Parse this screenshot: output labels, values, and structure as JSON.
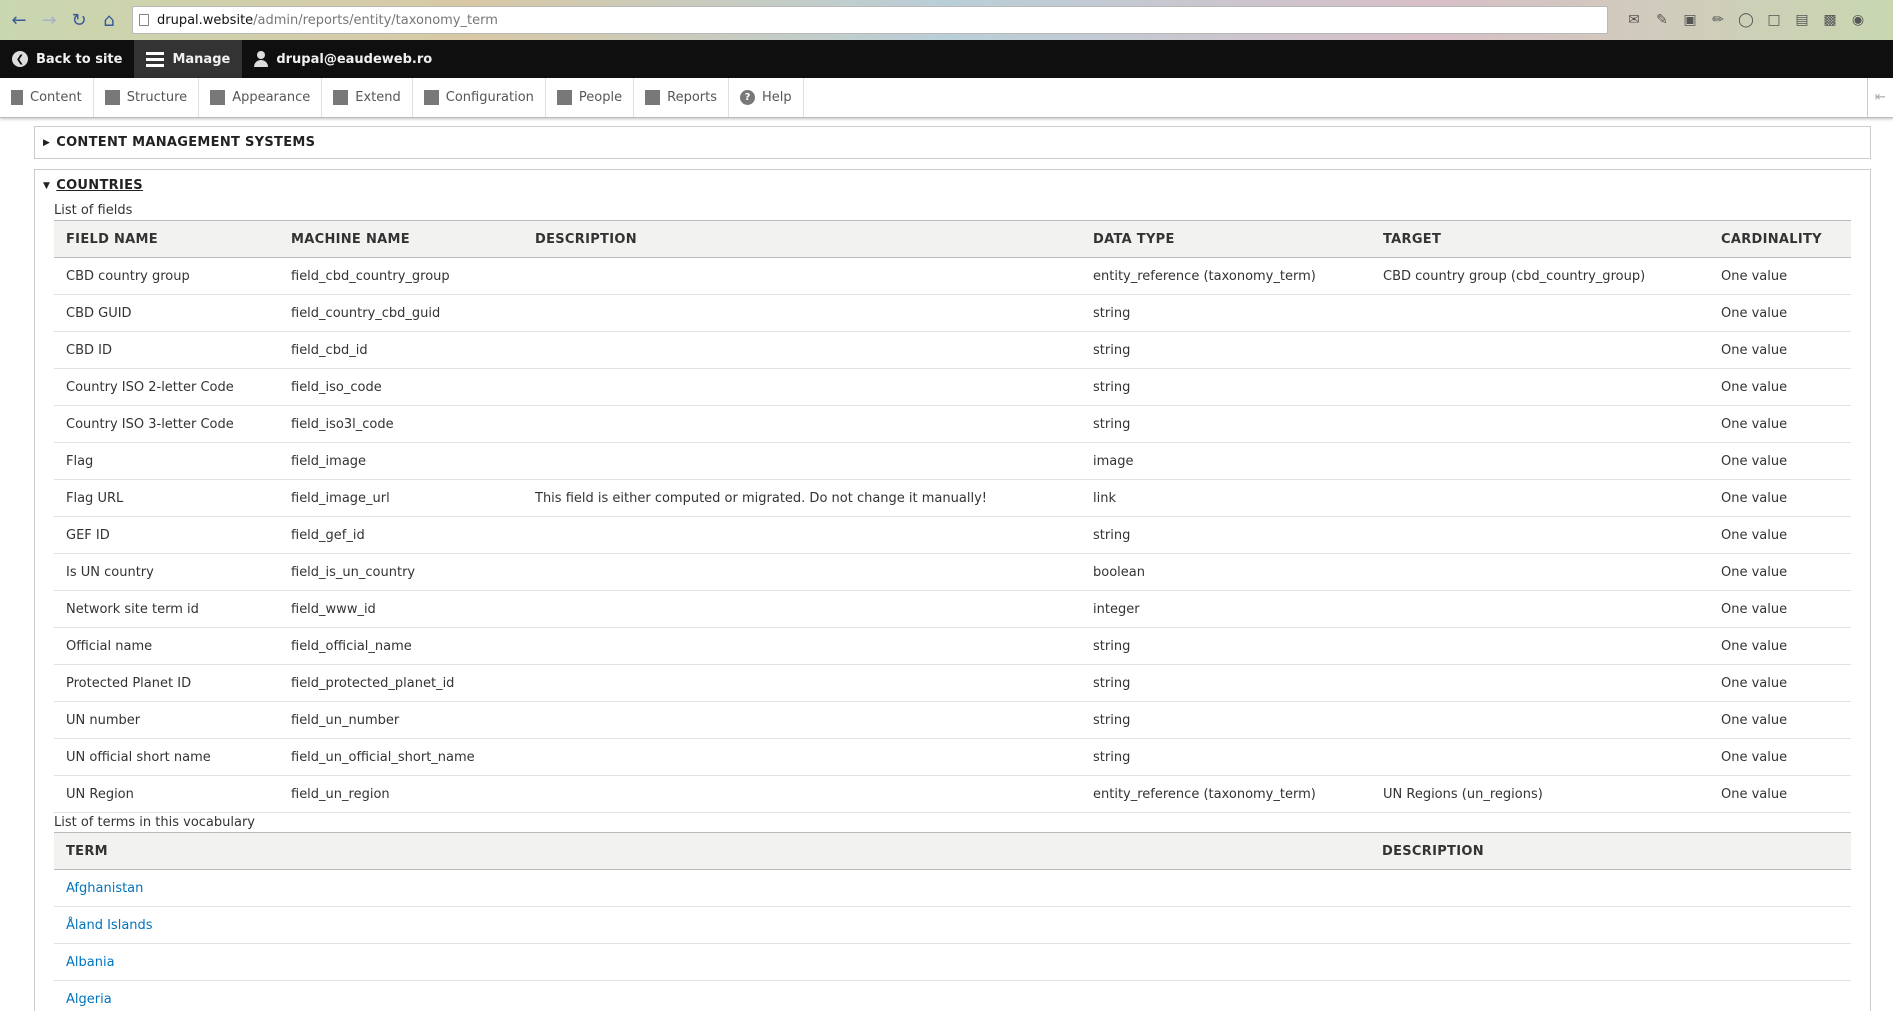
{
  "browser": {
    "url_host": "drupal.website",
    "url_path": "/admin/reports/entity/taxonomy_term"
  },
  "toolbar": {
    "back_label": "Back to site",
    "manage_label": "Manage",
    "user_label": "drupal@eaudeweb.ro"
  },
  "tray": {
    "items": [
      "Content",
      "Structure",
      "Appearance",
      "Extend",
      "Configuration",
      "People",
      "Reports",
      "Help"
    ]
  },
  "sections": {
    "cms": {
      "title": "CONTENT MANAGEMENT SYSTEMS"
    },
    "countries": {
      "title": "COUNTRIES",
      "fields_caption": "List of fields",
      "fields_headers": [
        "FIELD NAME",
        "MACHINE NAME",
        "DESCRIPTION",
        "DATA TYPE",
        "TARGET",
        "CARDINALITY"
      ],
      "fields": [
        [
          "CBD country group",
          "field_cbd_country_group",
          "",
          "entity_reference (taxonomy_term)",
          "CBD country group (cbd_country_group)",
          "One value"
        ],
        [
          "CBD GUID",
          "field_country_cbd_guid",
          "",
          "string",
          "",
          "One value"
        ],
        [
          "CBD ID",
          "field_cbd_id",
          "",
          "string",
          "",
          "One value"
        ],
        [
          "Country ISO 2-letter Code",
          "field_iso_code",
          "",
          "string",
          "",
          "One value"
        ],
        [
          "Country ISO 3-letter Code",
          "field_iso3l_code",
          "",
          "string",
          "",
          "One value"
        ],
        [
          "Flag",
          "field_image",
          "",
          "image",
          "",
          "One value"
        ],
        [
          "Flag URL",
          "field_image_url",
          "This field is either computed or migrated. Do not change it manually!",
          "link",
          "",
          "One value"
        ],
        [
          "GEF ID",
          "field_gef_id",
          "",
          "string",
          "",
          "One value"
        ],
        [
          "Is UN country",
          "field_is_un_country",
          "",
          "boolean",
          "",
          "One value"
        ],
        [
          "Network site term id",
          "field_www_id",
          "",
          "integer",
          "",
          "One value"
        ],
        [
          "Official name",
          "field_official_name",
          "",
          "string",
          "",
          "One value"
        ],
        [
          "Protected Planet ID",
          "field_protected_planet_id",
          "",
          "string",
          "",
          "One value"
        ],
        [
          "UN number",
          "field_un_number",
          "",
          "string",
          "",
          "One value"
        ],
        [
          "UN official short name",
          "field_un_official_short_name",
          "",
          "string",
          "",
          "One value"
        ],
        [
          "UN Region",
          "field_un_region",
          "",
          "entity_reference (taxonomy_term)",
          "UN Regions (un_regions)",
          "One value"
        ]
      ],
      "terms_caption": "List of terms in this vocabulary",
      "terms_headers": [
        "TERM",
        "DESCRIPTION"
      ],
      "terms": [
        "Afghanistan",
        "Åland Islands",
        "Albania",
        "Algeria"
      ]
    }
  },
  "colors": {
    "link": "#0074bd",
    "toolbar_bg": "#0f0f0f"
  }
}
